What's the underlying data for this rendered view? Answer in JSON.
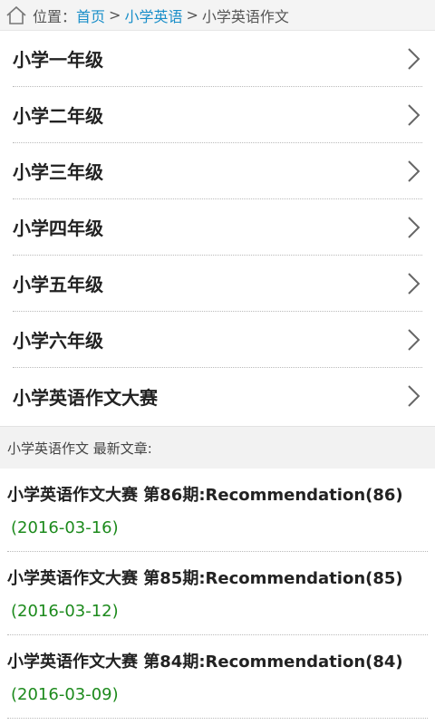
{
  "breadcrumb": {
    "prefix": "位置：",
    "home": "首页",
    "sep1": ">",
    "category": "小学英语",
    "sep2": ">",
    "current": "小学英语作文"
  },
  "grades": [
    {
      "label": "小学一年级"
    },
    {
      "label": "小学二年级"
    },
    {
      "label": "小学三年级"
    },
    {
      "label": "小学四年级"
    },
    {
      "label": "小学五年级"
    },
    {
      "label": "小学六年级"
    },
    {
      "label": "小学英语作文大赛"
    }
  ],
  "latest": {
    "header": "小学英语作文 最新文章:",
    "articles": [
      {
        "title": "小学英语作文大赛 第86期:Recommendation(86)",
        "date": "(2016-03-16)"
      },
      {
        "title": "小学英语作文大赛 第85期:Recommendation(85)",
        "date": "(2016-03-12)"
      },
      {
        "title": "小学英语作文大赛 第84期:Recommendation(84)",
        "date": "(2016-03-09)"
      }
    ]
  },
  "icons": {
    "home": "home-icon",
    "chevron": "chevron-right-icon"
  },
  "colors": {
    "link": "#1a8fc9",
    "date": "#1c8a1c"
  }
}
